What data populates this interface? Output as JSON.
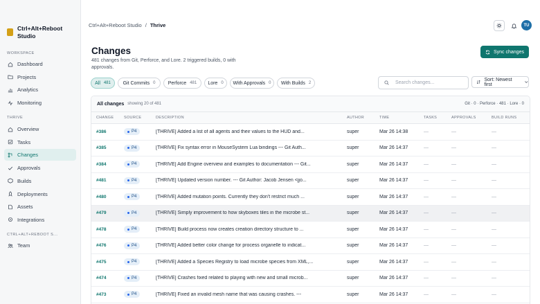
{
  "brand": {
    "name": "Ctrl+Alt+Reboot Studio"
  },
  "sidebar": {
    "workspace_label": "WORKSPACE",
    "workspace_items": [
      {
        "label": "Dashboard",
        "icon": "home-icon"
      },
      {
        "label": "Projects",
        "icon": "folder-icon"
      },
      {
        "label": "Analytics",
        "icon": "analytics-icon"
      },
      {
        "label": "Monitoring",
        "icon": "monitoring-icon"
      }
    ],
    "project_label": "THRIVE",
    "project_items": [
      {
        "label": "Overview",
        "icon": "overview-icon"
      },
      {
        "label": "Tasks",
        "icon": "tasks-icon"
      },
      {
        "label": "Changes",
        "icon": "changes-icon",
        "active": true
      },
      {
        "label": "Approvals",
        "icon": "check-icon"
      },
      {
        "label": "Builds",
        "icon": "builds-icon"
      },
      {
        "label": "Deployments",
        "icon": "deployments-icon"
      },
      {
        "label": "Assets",
        "icon": "assets-icon"
      },
      {
        "label": "Integrations",
        "icon": "integrations-icon"
      }
    ],
    "studio_label": "CTRL+ALT+REBOOT S...",
    "studio_items": [
      {
        "label": "Team",
        "icon": "team-icon"
      }
    ]
  },
  "header": {
    "breadcrumb_root": "Ctrl+Alt+Reboot Studio",
    "breadcrumb_sep": "/",
    "breadcrumb_current": "Thrive",
    "avatar_initials": "TU"
  },
  "page": {
    "title": "Changes",
    "subtitle": "481 changes from Git, Perforce, and Lore. 2 triggered builds, 0 with approvals.",
    "sync_label": "Sync changes"
  },
  "filters": [
    {
      "label": "All",
      "count": "481",
      "active": true
    },
    {
      "label": "Git Commits",
      "count": "0"
    },
    {
      "label": "Perforce",
      "count": "481"
    },
    {
      "label": "Lore",
      "count": "0"
    },
    {
      "label": "With Approvals",
      "count": "0"
    },
    {
      "label": "With Builds",
      "count": "2"
    }
  ],
  "search": {
    "placeholder": "Search changes..."
  },
  "sort": {
    "label": "Sort: Newest first"
  },
  "table": {
    "title": "All changes",
    "subtitle": "showing 20 of 481",
    "summary": "Git · 0 · Perforce · 481 · Lore · 0",
    "columns": [
      "CHANGE",
      "SOURCE",
      "DESCRIPTION",
      "AUTHOR",
      "TIME",
      "TASKS",
      "APPROVALS",
      "BUILD RUNS"
    ],
    "rows": [
      {
        "change": "#386",
        "source": "P4",
        "description": "[THRIVE] Added a list of all agents and their values to the HUD and...",
        "author": "super",
        "time": "Mar 26 14:38",
        "tasks": "—",
        "approvals": "—",
        "runs": "—"
      },
      {
        "change": "#385",
        "source": "P4",
        "description": "[THRIVE] Fix syntax error in MouseSystem Lua bindings --- Git Auth...",
        "author": "super",
        "time": "Mar 26 14:37",
        "tasks": "—",
        "approvals": "—",
        "runs": "—"
      },
      {
        "change": "#384",
        "source": "P4",
        "description": "[THRIVE] Add Engine overview and examples to documentation --- Git...",
        "author": "super",
        "time": "Mar 26 14:37",
        "tasks": "—",
        "approvals": "—",
        "runs": "—"
      },
      {
        "change": "#481",
        "source": "P4",
        "description": "[THRIVE] Updated version number. --- Git Author: Jacob Jensen <jjo...",
        "author": "super",
        "time": "Mar 26 14:37",
        "tasks": "—",
        "approvals": "—",
        "runs": "—"
      },
      {
        "change": "#480",
        "source": "P4",
        "description": "[THRIVE] Added mutation points. Currently they don't restrict much ...",
        "author": "super",
        "time": "Mar 26 14:37",
        "tasks": "—",
        "approvals": "—",
        "runs": "—"
      },
      {
        "change": "#479",
        "source": "P4",
        "description": "[THRIVE] Simply improvement to how skyboxes tiles in the microbe st...",
        "author": "super",
        "time": "Mar 26 14:37",
        "tasks": "—",
        "approvals": "—",
        "runs": "—",
        "highlight": true
      },
      {
        "change": "#478",
        "source": "P4",
        "description": "[THRIVE] Build process now creates creation directory structure to ...",
        "author": "super",
        "time": "Mar 26 14:37",
        "tasks": "—",
        "approvals": "—",
        "runs": "—"
      },
      {
        "change": "#476",
        "source": "P4",
        "description": "[THRIVE] Added better color change for process organelle to indicat...",
        "author": "super",
        "time": "Mar 26 14:37",
        "tasks": "—",
        "approvals": "—",
        "runs": "—"
      },
      {
        "change": "#475",
        "source": "P4",
        "description": "[THRIVE] Added a Species Registry to load microbe species from XML,...",
        "author": "super",
        "time": "Mar 26 14:37",
        "tasks": "—",
        "approvals": "—",
        "runs": "—"
      },
      {
        "change": "#474",
        "source": "P4",
        "description": "[THRIVE] Crashes fixed related to playing with new and small microb...",
        "author": "super",
        "time": "Mar 26 14:37",
        "tasks": "—",
        "approvals": "—",
        "runs": "—"
      },
      {
        "change": "#473",
        "source": "P4",
        "description": "[THRIVE] Fixed an invalid mesh name that was causing crashes. ---",
        "author": "super",
        "time": "Mar 26 14:37",
        "tasks": "—",
        "approvals": "—",
        "runs": "—"
      }
    ]
  },
  "colors": {
    "accent": "#0f766e",
    "accent_soft": "#e0efee",
    "badge_bg": "#e4eef8",
    "avatar": "#1e6fa8"
  }
}
